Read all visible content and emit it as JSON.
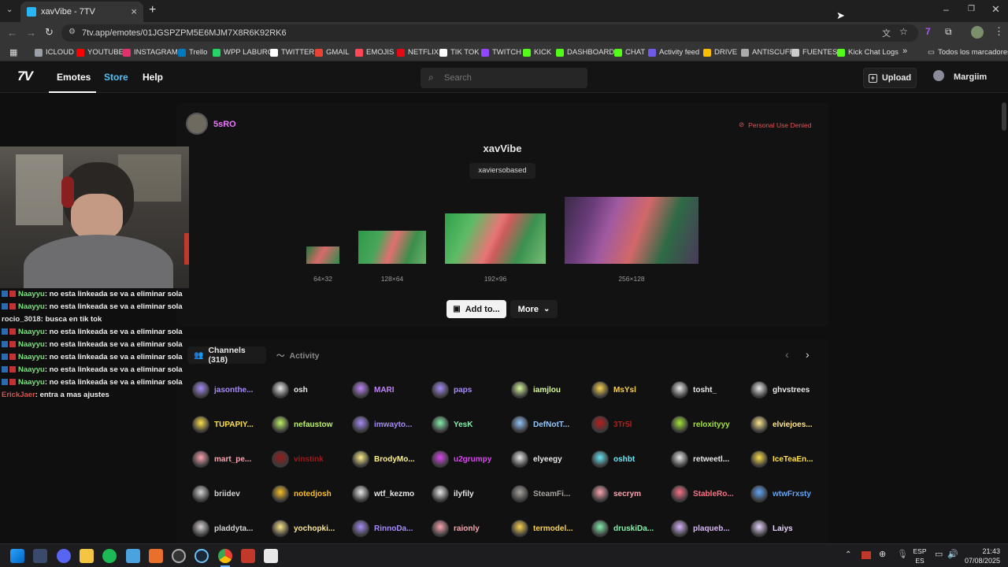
{
  "browser": {
    "tab_title": "xavVibe - 7TV",
    "url": "7tv.app/emotes/01JGSPZPM5E6MJM7X8R6K92RK6",
    "bookmarks": [
      {
        "label": "ICLOUD",
        "color": "#9aa0a6"
      },
      {
        "label": "YOUTUBE",
        "color": "#ff0000"
      },
      {
        "label": "INSTAGRAM",
        "color": "#e1306c"
      },
      {
        "label": "Trello",
        "color": "#0079bf"
      },
      {
        "label": "WPP LABURO",
        "color": "#25d366"
      },
      {
        "label": "TWITTER",
        "color": "#ffffff"
      },
      {
        "label": "GMAIL",
        "color": "#ea4335"
      },
      {
        "label": "EMOJIS",
        "color": "#ff4757"
      },
      {
        "label": "NETFLIX",
        "color": "#e50914"
      },
      {
        "label": "TIK TOK",
        "color": "#ffffff"
      },
      {
        "label": "TWITCH",
        "color": "#9146ff"
      },
      {
        "label": "KICK",
        "color": "#53fc18"
      },
      {
        "label": "DASHBOARD",
        "color": "#53fc18"
      },
      {
        "label": "CHAT",
        "color": "#53fc18"
      },
      {
        "label": "Activity feed",
        "color": "#6c5ce7"
      },
      {
        "label": "DRIVE",
        "color": "#fbbc04"
      },
      {
        "label": "ANTISCUFF",
        "color": "#aaaaaa"
      },
      {
        "label": "FUENTES",
        "color": "#cccccc"
      },
      {
        "label": "Kick Chat Logs",
        "color": "#53fc18"
      }
    ],
    "all_bookmarks": "Todos los marcadores"
  },
  "site": {
    "logo": "7TV",
    "nav": {
      "emotes": "Emotes",
      "store": "Store",
      "help": "Help"
    },
    "search_placeholder": "Search",
    "upload_label": "Upload",
    "username": "Margiim"
  },
  "emote": {
    "owner": "5sRO",
    "name": "xavVibe",
    "tag": "xaviersobased",
    "personal_use": "Personal Use Denied",
    "sizes": [
      "64×32",
      "128×64",
      "192×96",
      "256×128"
    ],
    "add_to_label": "Add to...",
    "more_label": "More"
  },
  "tabs": {
    "channels_label": "Channels (318)",
    "activity_label": "Activity"
  },
  "channels": [
    {
      "name": "jasonthe...",
      "color": "#a78bfa"
    },
    {
      "name": "osh",
      "color": "#e8e8e8"
    },
    {
      "name": "MARI",
      "color": "#c084fc"
    },
    {
      "name": "paps",
      "color": "#a78bfa"
    },
    {
      "name": "iamjlou",
      "color": "#d9f99d"
    },
    {
      "name": "MsYsl",
      "color": "#fcd34d"
    },
    {
      "name": "tosht_",
      "color": "#e8e8e8"
    },
    {
      "name": "ghvstrees",
      "color": "#e8e8e8"
    },
    {
      "name": "TUPAPIY...",
      "color": "#fde047"
    },
    {
      "name": "nefaustow",
      "color": "#bef264"
    },
    {
      "name": "imwayto...",
      "color": "#a78bfa"
    },
    {
      "name": "YesK",
      "color": "#86efac"
    },
    {
      "name": "DefNotT...",
      "color": "#93c5fd"
    },
    {
      "name": "3Tr5l",
      "color": "#b91c1c"
    },
    {
      "name": "reloxityyy",
      "color": "#a3e635"
    },
    {
      "name": "elviejoes...",
      "color": "#fde68a"
    },
    {
      "name": "mart_pe...",
      "color": "#fda4af"
    },
    {
      "name": "vinstink",
      "color": "#991b1b"
    },
    {
      "name": "BrodyMo...",
      "color": "#fef08a"
    },
    {
      "name": "u2grumpy",
      "color": "#d946ef"
    },
    {
      "name": "elyeegy",
      "color": "#e8e8e8"
    },
    {
      "name": "oshbt",
      "color": "#67e8f9"
    },
    {
      "name": "retweetl...",
      "color": "#e8e8e8"
    },
    {
      "name": "IceTeaEn...",
      "color": "#fde047"
    },
    {
      "name": "briidev",
      "color": "#d4d4d4"
    },
    {
      "name": "notedjosh",
      "color": "#fbbf24"
    },
    {
      "name": "wtf_kezmo",
      "color": "#e8e8e8"
    },
    {
      "name": "ilyfily",
      "color": "#e8e8e8"
    },
    {
      "name": "SteamFi...",
      "color": "#a8a29e"
    },
    {
      "name": "secrym",
      "color": "#fda4af"
    },
    {
      "name": "StableRo...",
      "color": "#fb7185"
    },
    {
      "name": "wtwFrxsty",
      "color": "#60a5fa"
    },
    {
      "name": "pladdyta...",
      "color": "#d6d3d1"
    },
    {
      "name": "yochopki...",
      "color": "#fde68a"
    },
    {
      "name": "RinnoDa...",
      "color": "#a78bfa"
    },
    {
      "name": "raionly",
      "color": "#fda4af"
    },
    {
      "name": "termodel...",
      "color": "#fcd34d"
    },
    {
      "name": "druskiDa...",
      "color": "#86efac"
    },
    {
      "name": "plaqueb...",
      "color": "#d8b4fe"
    },
    {
      "name": "Laiys",
      "color": "#e9d5ff"
    }
  ],
  "chat": [
    {
      "user": "Naayyu",
      "text": ": no esta linkeada se va a eliminar sola",
      "color": "#7ee07e",
      "badges": true
    },
    {
      "user": "Naayyu",
      "text": ": no esta linkeada se va a eliminar sola",
      "color": "#7ee07e",
      "badges": true
    },
    {
      "user": "rocio_3018",
      "text": ": busca en tik tok",
      "color": "#e0e0e0",
      "badges": false
    },
    {
      "user": "Naayyu",
      "text": ": no esta linkeada se va a eliminar sola",
      "color": "#7ee07e",
      "badges": true
    },
    {
      "user": "Naayyu",
      "text": ": no esta linkeada se va a eliminar sola",
      "color": "#7ee07e",
      "badges": true
    },
    {
      "user": "Naayyu",
      "text": ": no esta linkeada se va a eliminar sola",
      "color": "#7ee07e",
      "badges": true
    },
    {
      "user": "Naayyu",
      "text": ": no esta linkeada se va a eliminar sola",
      "color": "#7ee07e",
      "badges": true
    },
    {
      "user": "Naayyu",
      "text": ": no esta linkeada se va a eliminar sola",
      "color": "#7ee07e",
      "badges": true
    },
    {
      "user": "ErickJaer",
      "text": ": entra a mas ajustes",
      "color": "#d9534f",
      "badges": false
    }
  ],
  "taskbar": {
    "lang_top": "ESP",
    "lang_bottom": "ES",
    "time": "21:43",
    "date": "07/08/2025"
  },
  "colors": {
    "accent": "#4fc3f7",
    "denied": "#e05555"
  }
}
